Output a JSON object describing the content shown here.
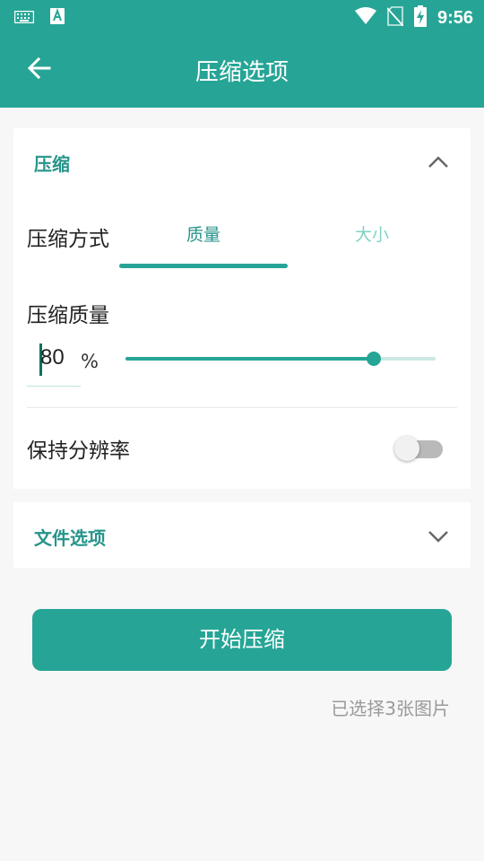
{
  "status_bar": {
    "time": "9:56",
    "icons": [
      "keyboard-icon",
      "font-a-icon",
      "wifi-icon",
      "no-sim-icon",
      "battery-charging-icon"
    ]
  },
  "app_bar": {
    "title": "压缩选项",
    "back_icon": "arrow-left-icon"
  },
  "compress_section": {
    "title": "压缩",
    "expanded": true,
    "method": {
      "label": "压缩方式",
      "options": [
        "质量",
        "大小"
      ],
      "selected": "质量"
    },
    "quality": {
      "label": "压缩质量",
      "value": "80",
      "unit": "%",
      "slider_fraction": 0.8
    },
    "keep_resolution": {
      "label": "保持分辨率",
      "enabled": false
    }
  },
  "file_section": {
    "title": "文件选项",
    "expanded": false
  },
  "actions": {
    "start_label": "开始压缩"
  },
  "footer": {
    "selected_count_text": "已选择3张图片"
  },
  "colors": {
    "primary": "#26a596",
    "section_title": "#26948a",
    "inactive_tab": "#7fd3c6",
    "background": "#f7f7f7"
  }
}
